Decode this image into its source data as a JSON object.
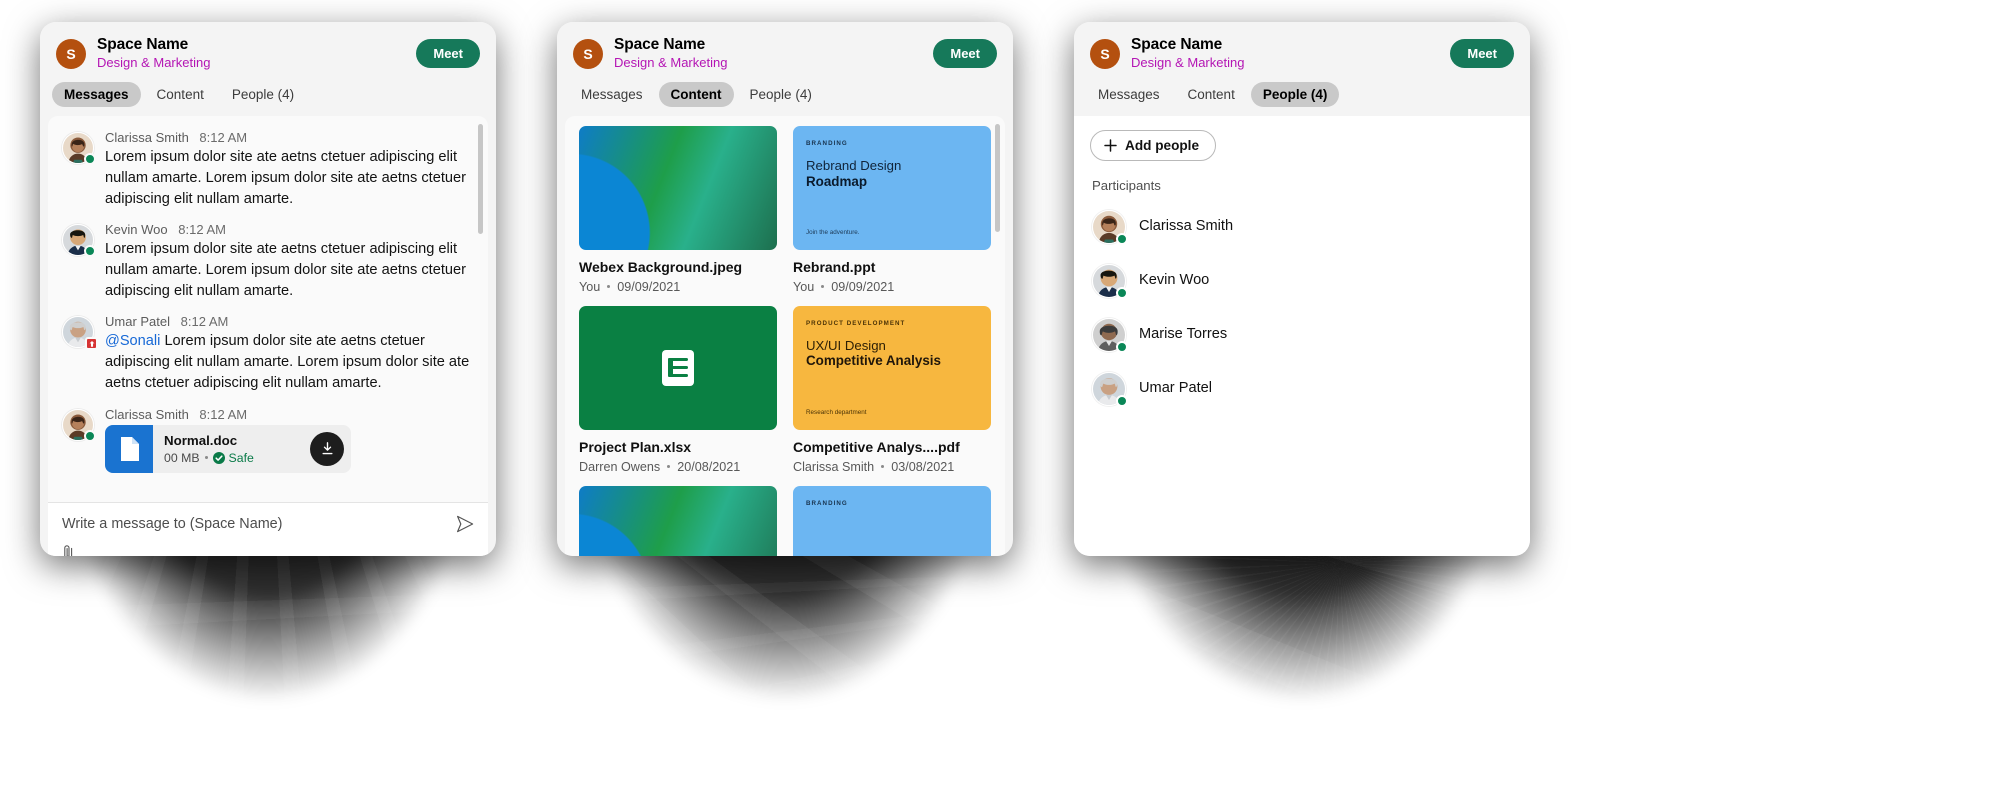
{
  "header": {
    "avatar_initial": "S",
    "avatar_color": "#b4500f",
    "space_name": "Space Name",
    "space_subtitle": "Design & Marketing",
    "meet_label": "Meet",
    "meet_color": "#16795a",
    "subtitle_color": "#b415b4"
  },
  "tabs": [
    {
      "label": "Messages"
    },
    {
      "label": "Content"
    },
    {
      "label": "People (4)"
    }
  ],
  "panels": {
    "messages": {
      "active_tab": "Messages"
    },
    "content": {
      "active_tab": "Content"
    },
    "people": {
      "active_tab": "People (4)"
    }
  },
  "messages": [
    {
      "author": "Clarissa Smith",
      "time": "8:12 AM",
      "presence": "available",
      "avatar": "woman-1",
      "text": "Lorem ipsum dolor site ate aetns ctetuer adipiscing elit nullam amarte. Lorem ipsum dolor site ate aetns ctetuer adipiscing elit nullam amarte."
    },
    {
      "author": "Kevin Woo",
      "time": "8:12 AM",
      "presence": "available",
      "avatar": "man-1",
      "text": "Lorem ipsum dolor site ate aetns ctetuer adipiscing elit nullam amarte. Lorem ipsum dolor site ate aetns ctetuer adipiscing elit nullam amarte."
    },
    {
      "author": "Umar Patel",
      "time": "8:12 AM",
      "presence": "urgent",
      "avatar": "man-2",
      "mention": "@Sonali",
      "text": " Lorem ipsum dolor site ate aetns ctetuer adipiscing elit nullam amarte. Lorem ipsum dolor site ate aetns ctetuer adipiscing elit nullam amarte."
    },
    {
      "author": "Clarissa Smith",
      "time": "8:12 AM",
      "presence": "available",
      "avatar": "woman-1",
      "attachment": {
        "name": "Normal.doc",
        "size": "00 MB",
        "status": "Safe",
        "status_color": "#0a7a48",
        "icon_color": "#1a73d0"
      }
    }
  ],
  "composer": {
    "placeholder": "Write a message to (Space Name)",
    "send_icon": "send-icon",
    "attach_icon": "paperclip-icon"
  },
  "content_files": [
    {
      "name": "Webex Background.jpeg",
      "owner": "You",
      "date": "09/09/2021",
      "thumb_type": "gradient"
    },
    {
      "name": "Rebrand.ppt",
      "owner": "You",
      "date": "09/09/2021",
      "thumb_type": "doc-blue",
      "thumb": {
        "kicker": "BRANDING",
        "line1": "Rebrand Design",
        "line2": "Roadmap",
        "footer": "Join the adventure."
      }
    },
    {
      "name": "Project Plan.xlsx",
      "owner": "Darren Owens",
      "date": "20/08/2021",
      "thumb_type": "sheet-green"
    },
    {
      "name": "Competitive Analys....pdf",
      "owner": "Clarissa Smith",
      "date": "03/08/2021",
      "thumb_type": "doc-orange",
      "thumb": {
        "kicker": "PRODUCT DEVELOPMENT",
        "line1": "UX/UI Design",
        "line2": "Competitive Analysis",
        "footer": "Research department"
      }
    },
    {
      "name": "",
      "owner": "",
      "date": "",
      "thumb_type": "gradient"
    },
    {
      "name": "",
      "owner": "",
      "date": "",
      "thumb_type": "doc-blue",
      "thumb": {
        "kicker": "BRANDING",
        "line1": "",
        "line2": "",
        "footer": ""
      }
    }
  ],
  "people": {
    "add_people_label": "Add people",
    "add_icon": "plus-icon",
    "participants_label": "Participants",
    "participants": [
      {
        "name": "Clarissa Smith",
        "presence": "available",
        "avatar": "woman-1"
      },
      {
        "name": "Kevin Woo",
        "presence": "available",
        "avatar": "man-1"
      },
      {
        "name": "Marise Torres",
        "presence": "available",
        "avatar": "woman-2"
      },
      {
        "name": "Umar Patel",
        "presence": "available",
        "avatar": "man-2"
      }
    ]
  }
}
